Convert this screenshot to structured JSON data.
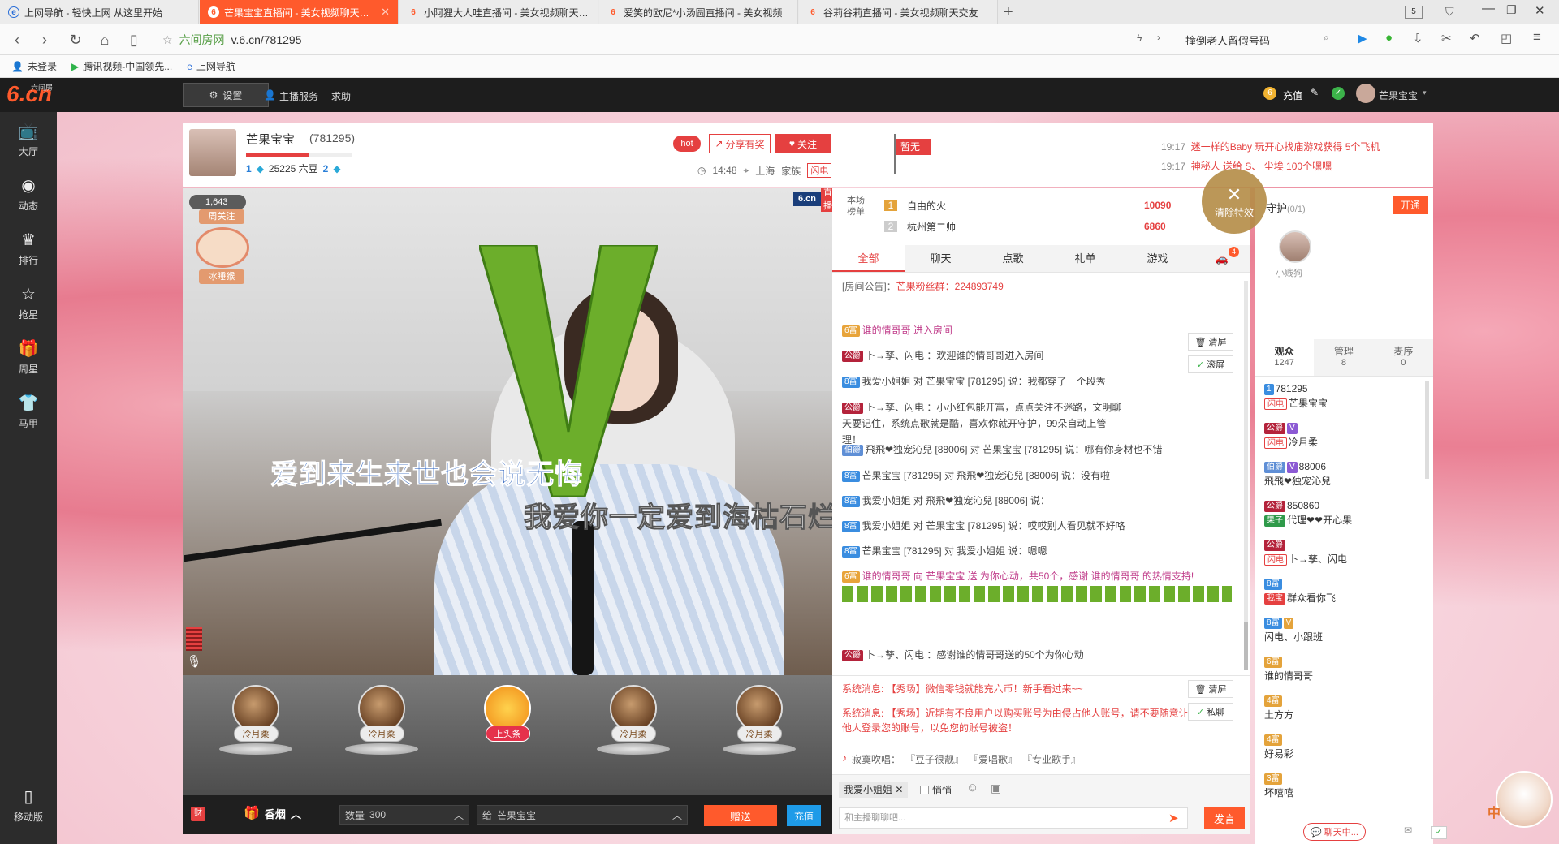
{
  "browser": {
    "tabs": [
      {
        "title": "上网导航 - 轻快上网 从这里开始",
        "icon": "browser-e-icon",
        "active": false
      },
      {
        "title": "芒果宝宝直播间 - 美女视频聊天交友",
        "icon": "6cn-icon",
        "active": true
      },
      {
        "title": "小阿狸大人哇直播间 - 美女视频聊天交友",
        "icon": "6cn-icon",
        "active": false
      },
      {
        "title": "爱笑的欧尼*小汤圆直播间 - 美女视频",
        "icon": "6cn-icon",
        "active": false
      },
      {
        "title": "谷莉谷莉直播间 - 美女视频聊天交友",
        "icon": "6cn-icon",
        "active": false
      }
    ],
    "new_tab": "+",
    "tab_count": "5",
    "address_site": "六间房网",
    "address_url": "v.6.cn/781295",
    "search_text": "撞倒老人留假号码",
    "bookmarks": [
      "未登录",
      "腾讯视频-中国领先...",
      "上网导航"
    ]
  },
  "site": {
    "logo": "6.cn",
    "logo_sub": "六间房",
    "settings_label": "设置",
    "service_label": "主播服务",
    "help_label": "求助",
    "recharge_label": "充值",
    "user_name": "芒果宝宝",
    "left_nav": [
      {
        "label": "大厅",
        "icon": "tv-icon"
      },
      {
        "label": "动态",
        "icon": "compass-icon"
      },
      {
        "label": "排行",
        "icon": "crown-icon"
      },
      {
        "label": "抢星",
        "icon": "star-icon"
      },
      {
        "label": "周星",
        "icon": "gift-icon"
      },
      {
        "label": "马甲",
        "icon": "shirt-icon"
      }
    ],
    "mobile_label": "移动版"
  },
  "room": {
    "anchor_name": "芒果宝宝",
    "room_id": "(781295)",
    "rank_label": "1",
    "beans": "25225 六豆",
    "rank2_label": "2",
    "time": "14:48",
    "location": "上海",
    "family_label": "家族",
    "family_badge": "闪电",
    "hot_label": "hot",
    "share_label": "分享有奖",
    "follow_label": "关注",
    "flag_label": "暂无",
    "notices": [
      {
        "time": "19:17",
        "text": "迷一样的Baby 玩开心找庙游戏获得 5个飞机"
      },
      {
        "time": "19:17",
        "text": "神秘人 送给 S、 尘埃 100个嘿嘿"
      }
    ]
  },
  "video": {
    "watermark": "6.cn",
    "live_label": "直播",
    "fans_count": "1,643",
    "badge_top": "周关注",
    "badge_bottom": "冰睡猴",
    "lyric1": "爱到来生来世也会说无悔",
    "lyric2": "我爱你一定爱到海枯石烂永远不后悔",
    "clear_effect_label": "清除特效"
  },
  "gifts": {
    "slots": [
      "冷月柔",
      "冷月柔",
      "上头条",
      "冷月柔",
      "冷月柔"
    ],
    "gift_name": "香烟",
    "qty_label": "数量",
    "qty": "300",
    "to_label": "给",
    "to_name": "芒果宝宝",
    "send_label": "赠送",
    "recharge_label": "充值"
  },
  "chat": {
    "rank_title": "本场榜单",
    "rank": [
      {
        "pos": "1",
        "name": "自由的火",
        "score": "10090"
      },
      {
        "pos": "2",
        "name": "杭州第二帅",
        "score": "6860"
      }
    ],
    "tabs": [
      "全部",
      "聊天",
      "点歌",
      "礼单",
      "游戏"
    ],
    "car_badge": "4",
    "announce_label": "[房间公告]：",
    "announce_text": "芒果粉丝群：224893749",
    "clear_label": "清屏",
    "scroll_label": "滚屏",
    "messages": [
      {
        "lv": "6富",
        "text": "谁的情哥哥 进入房间"
      },
      {
        "lv": "公爵",
        "text": "卜→孳、闪电 ：欢迎谁的情哥哥进入房间"
      },
      {
        "lv": "8富",
        "text": "我爱小姐姐 对 芒果宝宝 [781295] 说：我都穿了一个段秀"
      },
      {
        "lv": "公爵",
        "text": "卜→孳、闪电 ：小小红包能开富，点点关注不迷路，文明聊天要记住，系统点歌就是酷，喜欢你就开守护，99朵自动上管理！"
      },
      {
        "lv": "伯爵",
        "text": "飛飛❤独宠沁兒 [88006] 对 芒果宝宝 [781295] 说：哪有你身材也不错"
      },
      {
        "lv": "8富",
        "text": "芒果宝宝 [781295] 对 飛飛❤独宠沁兒 [88006] 说：没有啦"
      },
      {
        "lv": "8富",
        "text": "我爱小姐姐 对 飛飛❤独宠沁兒 [88006] 说："
      },
      {
        "lv": "8富",
        "text": "我爱小姐姐 对 芒果宝宝 [781295] 说：哎哎别人看见就不好咯"
      },
      {
        "lv": "8富",
        "text": "芒果宝宝 [781295] 对 我爱小姐姐 说：嗯嗯"
      },
      {
        "lv": "6富",
        "text": "谁的情哥哥 向 芒果宝宝 送 为你心动，共50个，感谢 谁的情哥哥 的热情支持!"
      },
      {
        "lv": "公爵",
        "text": "卜→孳、闪电 ：感谢谁的情哥哥送的50个为你心动"
      }
    ],
    "sys_messages": [
      "系统消息: 【秀场】微信零钱就能充六币！新手看过来~~",
      "系统消息: 【秀场】近期有不良用户以购买账号为由侵占他人账号，请不要随意让他人登录您的账号，以免您的账号被盗！"
    ],
    "sys_clear_label": "清屏",
    "private_label": "私聊",
    "song_prefix": "寂寞吹唱：",
    "songs": [
      "『豆子很靓』",
      "『爱唱歌』",
      "『专业歌手』"
    ],
    "reply_to": "我爱小姐姐",
    "whisper_label": "悄悄",
    "input_placeholder": "和主播聊聊吧...",
    "send_label": "发言"
  },
  "right": {
    "guard_label": "守护",
    "guard_count": "(0/1)",
    "open_label": "开通",
    "guard_user": "小贱狗",
    "tabs": [
      {
        "label": "观众",
        "count": "1247"
      },
      {
        "label": "管理",
        "count": "8"
      },
      {
        "label": "麦序",
        "count": "0"
      }
    ],
    "audience": [
      {
        "id": "781295",
        "name": "芒果宝宝",
        "b1": "1",
        "b2": "闪电"
      },
      {
        "id": "",
        "name": "冷月柔",
        "b1": "公爵",
        "b2": "闪电"
      },
      {
        "id": "88006",
        "name": "飛飛❤独宠沁兒",
        "b1": "伯爵",
        "b2": "V"
      },
      {
        "id": "850860",
        "name": "代理❤❤开心果",
        "b1": "公爵",
        "b2": "果子"
      },
      {
        "id": "",
        "name": "卜→孳、闪电",
        "b1": "公爵",
        "b2": "闪电"
      },
      {
        "id": "",
        "name": "群众看你飞",
        "b1": "8富",
        "b2": "我宝"
      },
      {
        "id": "",
        "name": "闪电、小跟班",
        "b1": "8富",
        "b2": "V"
      },
      {
        "id": "",
        "name": "谁的情哥哥",
        "b1": "6富",
        "b2": ""
      },
      {
        "id": "",
        "name": "土方方",
        "b1": "4富",
        "b2": ""
      },
      {
        "id": "",
        "name": "好易彩",
        "b1": "4富",
        "b2": ""
      },
      {
        "id": "",
        "name": "坏嘻嘻",
        "b1": "3富",
        "b2": ""
      }
    ],
    "chat_float_label": "聊天中..."
  },
  "colors": {
    "accent": "#ff5a2c",
    "live_red": "#e54040",
    "level_orange": "#e8a43a",
    "purple_name": "#c03c8a"
  }
}
